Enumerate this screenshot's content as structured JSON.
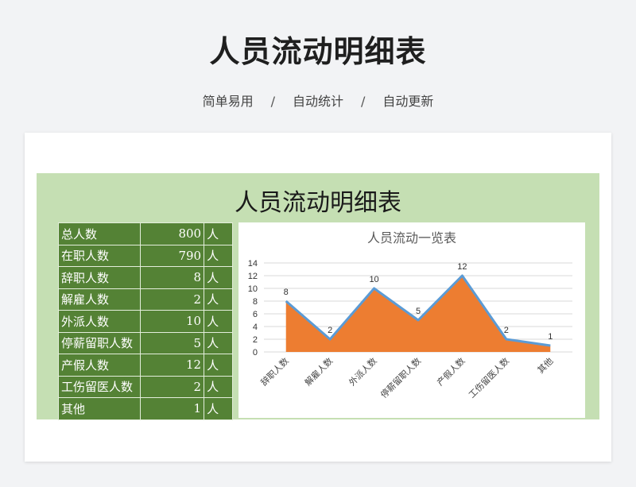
{
  "header": {
    "title": "人员流动明细表",
    "tags": [
      "简单易用",
      "自动统计",
      "自动更新"
    ],
    "separator": "/"
  },
  "sheet": {
    "title": "人员流动明细表",
    "stats": [
      {
        "label": "总人数",
        "value": "800",
        "unit": "人"
      },
      {
        "label": "在职人数",
        "value": "790",
        "unit": "人"
      },
      {
        "label": "辞职人数",
        "value": "8",
        "unit": "人"
      },
      {
        "label": "解雇人数",
        "value": "2",
        "unit": "人"
      },
      {
        "label": "外派人数",
        "value": "10",
        "unit": "人"
      },
      {
        "label": "停薪留职人数",
        "value": "5",
        "unit": "人"
      },
      {
        "label": "产假人数",
        "value": "12",
        "unit": "人"
      },
      {
        "label": "工伤留医人数",
        "value": "2",
        "unit": "人"
      },
      {
        "label": "其他",
        "value": "1",
        "unit": "人"
      }
    ]
  },
  "colors": {
    "table_fill": "#548235",
    "sheet_bg": "#c5dfb3",
    "area_fill": "#ed7d31",
    "line": "#5b9bd5"
  },
  "chart_data": {
    "type": "area",
    "title": "人员流动一览表",
    "categories": [
      "辞职人数",
      "解雇人数",
      "外派人数",
      "停薪留职人数",
      "产假人数",
      "工伤留医人数",
      "其他"
    ],
    "values": [
      8,
      2,
      10,
      5,
      12,
      2,
      1
    ],
    "ylim": [
      0,
      14
    ],
    "yticks": [
      0,
      2,
      4,
      6,
      8,
      10,
      12,
      14
    ],
    "grid": true,
    "data_labels": true,
    "legend": "none"
  }
}
